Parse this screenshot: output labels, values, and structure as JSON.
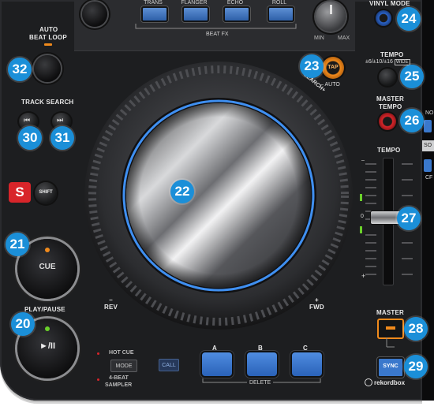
{
  "top_fx": {
    "buttons": [
      "TRANS",
      "FLANGER",
      "ECHO",
      "ROLL"
    ],
    "beat_fx_label": "BEAT FX",
    "min_label": "MIN",
    "max_label": "MAX",
    "vinyl_mode_label": "VINYL MODE"
  },
  "left": {
    "auto_beat_loop_line1": "AUTO",
    "auto_beat_loop_line2": "BEAT LOOP",
    "track_search_label": "TRACK SEARCH",
    "prev_icon": "⏮",
    "next_icon": "⏭",
    "s_badge": "S",
    "shift_label": "SHIFT",
    "cue_label": "CUE",
    "play_pause_label": "PLAY/PAUSE",
    "play_pause_glyph": "►/II"
  },
  "jog": {
    "tap_label": "TAP",
    "auto_label": "AUTO",
    "search_label": "SEARCH",
    "rev_label": "REV",
    "fwd_label": "FWD",
    "minus": "–",
    "plus": "+"
  },
  "right": {
    "tempo_label": "TEMPO",
    "tempo_range": "±6/±10/±16",
    "wide_label": "WIDE",
    "master_tempo_line1": "MASTER",
    "master_tempo_line2": "TEMPO",
    "tempo_fader_label": "TEMPO",
    "zero_label": "0",
    "master_label": "MASTER",
    "sync_label": "SYNC",
    "rekordbox_label": "rekordbox"
  },
  "bottom": {
    "hot_cue_label": "HOT CUE",
    "mode_label": "MODE",
    "beat_sampler_line1": "4-BEAT",
    "beat_sampler_line2": "SAMPLER",
    "call_label": "CALL",
    "pads": [
      "A",
      "B",
      "C"
    ],
    "delete_label": "DELETE"
  },
  "callouts": {
    "n20": "20",
    "n21": "21",
    "n22": "22",
    "n23": "23",
    "n24": "24",
    "n25": "25",
    "n26": "26",
    "n27": "27",
    "n28": "28",
    "n29": "29",
    "n30": "30",
    "n31": "31",
    "n32": "32"
  },
  "edge_text": {
    "no": "NO",
    "so": "SO",
    "cf": "CF"
  },
  "colors": {
    "callout_blue": "#1b8fd8",
    "pad_blue": "#3a78cc",
    "tap_orange": "#f08a1c",
    "shift_red": "#d8252a",
    "master_tempo_red": "#d8252a",
    "tempo_led_green": "#6ad12a",
    "jog_ring_blue": "#3f8ff0"
  }
}
